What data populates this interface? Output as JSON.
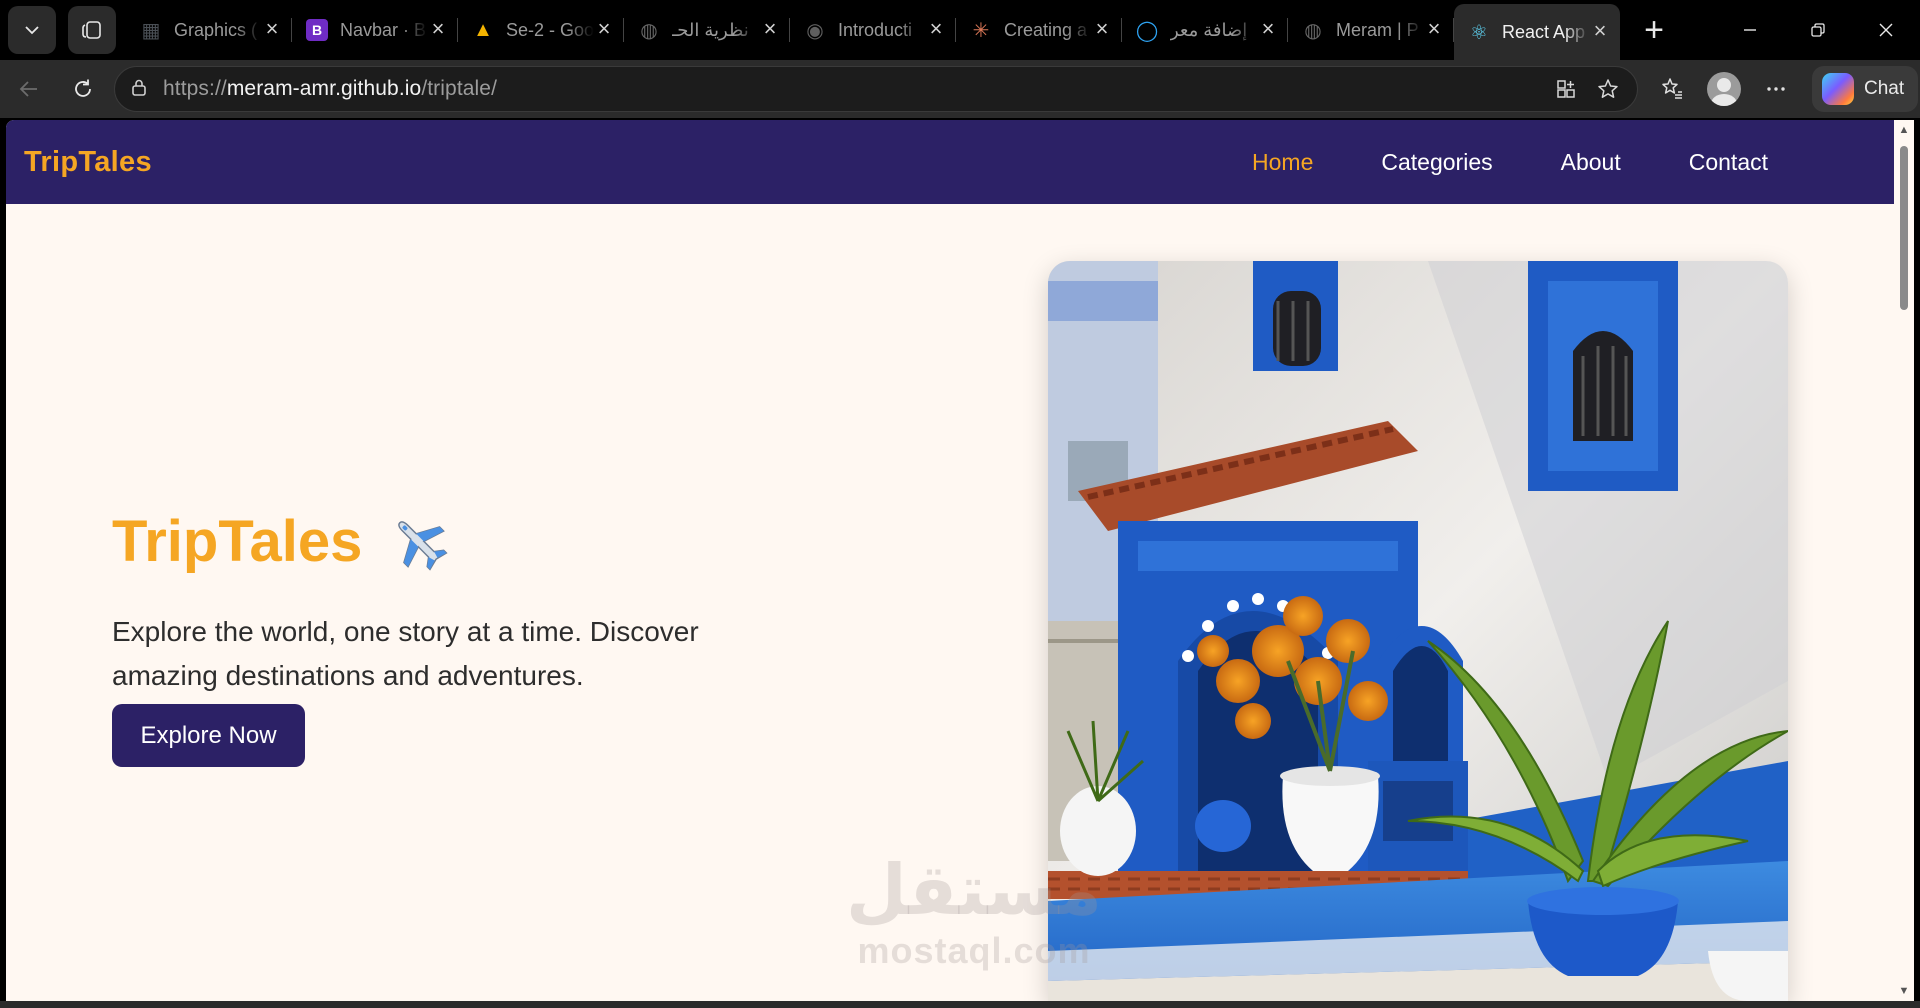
{
  "browser": {
    "tabs": [
      {
        "title": "Graphics (",
        "icon": "graphics-favicon-icon",
        "color": "#4a4f55"
      },
      {
        "title": "Navbar · B",
        "icon": "bootstrap-favicon-icon",
        "color": "#6f2cc4"
      },
      {
        "title": "Se-2 - Goo",
        "icon": "google-drive-icon",
        "color": "#f4b400"
      },
      {
        "title": "نظرية الحـ",
        "icon": "globe-icon",
        "color": "#666666"
      },
      {
        "title": "Introducti",
        "icon": "podcast-icon",
        "color": "#5f5f5f"
      },
      {
        "title": "Creating a",
        "icon": "claude-icon",
        "color": "#d97757"
      },
      {
        "title": "إضافة معر",
        "icon": "mostaql-favicon-icon",
        "color": "#2ea3f2"
      },
      {
        "title": "Meram | P",
        "icon": "globe-icon",
        "color": "#666666"
      },
      {
        "title": "React App",
        "icon": "react-icon",
        "color": "#61dafb",
        "active": true
      }
    ],
    "url_prefix": "https://",
    "url_host": "meram-amr.github.io",
    "url_path": "/triptale/",
    "chat_label": "Chat"
  },
  "site": {
    "brand": "TripTales",
    "nav": [
      "Home",
      "Categories",
      "About",
      "Contact"
    ],
    "active_nav": "Home",
    "accent_color": "#f5a623",
    "nav_bg_color": "#2c2166"
  },
  "hero": {
    "title": "TripTales",
    "title_icon": "airplane-icon",
    "text": "Explore the world, one story at a time. Discover amazing destinations and adventures.",
    "cta": "Explore Now",
    "image": "chefchaouen-blue-doorway-photo"
  },
  "watermark": {
    "arabic": "مستقل",
    "latin": "mostaql.com"
  }
}
